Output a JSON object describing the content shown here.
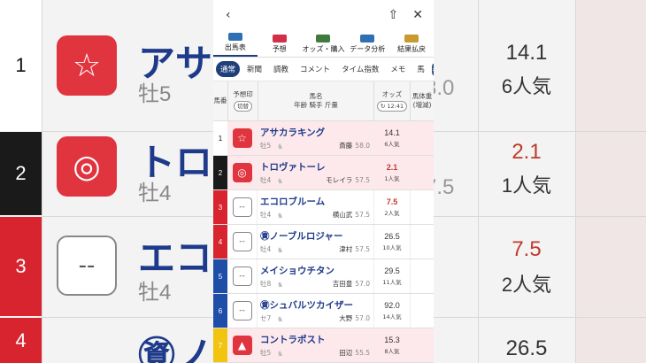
{
  "topbar": {
    "back_icon": "‹",
    "share_icon": "⇧",
    "close_icon": "✕"
  },
  "nav": [
    {
      "label": "出馬表",
      "icon": "table-icon",
      "color": "#2f6fb3",
      "active": true
    },
    {
      "label": "予想",
      "icon": "target-icon",
      "color": "#d0304a",
      "active": false
    },
    {
      "label": "オッズ・購入",
      "icon": "grid-icon",
      "color": "#3f7a3f",
      "active": false
    },
    {
      "label": "データ分析",
      "icon": "bar-chart-icon",
      "color": "#2f6fb3",
      "active": false
    },
    {
      "label": "結果払戻",
      "icon": "coins-icon",
      "color": "#c99a2e",
      "active": false
    }
  ],
  "subtabs": [
    "通常",
    "新聞",
    "調教",
    "コメント",
    "タイム指数",
    "メモ",
    "馬"
  ],
  "subtab_arrow": "›",
  "header": {
    "num": "馬番",
    "mark": "予想印",
    "mark_toggle": "切替",
    "name_line1": "馬名",
    "name_line2": "年齢 騎手 斤量",
    "odds": "オッズ",
    "odds_time": "12:41",
    "weight_line1": "馬体重",
    "weight_line2": "(増減)"
  },
  "horses": [
    {
      "num": "1",
      "gate_color": "#ffffff",
      "num_color": "#111",
      "mark": "☆",
      "mark_bg": "#e0343f",
      "name": "アサカラキング",
      "sub": "牡5",
      "jockey": "斎藤",
      "weight": "58.0",
      "odds": "14.1",
      "odds_red": false,
      "pop": "6人気",
      "pink": true
    },
    {
      "num": "2",
      "gate_color": "#1a1a1a",
      "num_color": "#fff",
      "mark": "◎",
      "mark_bg": "#e0343f",
      "name": "トロヴァトーレ",
      "sub": "牡4",
      "jockey": "モレイラ",
      "weight": "57.5",
      "odds": "2.1",
      "odds_red": true,
      "pop": "1人気",
      "pink": true
    },
    {
      "num": "3",
      "gate_color": "#d8242e",
      "num_color": "#fff",
      "mark": "--",
      "mark_bg": "",
      "name": "エコロブルーム",
      "sub": "牡4",
      "jockey": "横山武",
      "weight": "57.5",
      "odds": "7.5",
      "odds_red": true,
      "pop": "2人気",
      "pink": false
    },
    {
      "num": "4",
      "gate_color": "#d8242e",
      "num_color": "#fff",
      "mark": "--",
      "mark_bg": "",
      "name": "㊮ノーブルロジャー",
      "sub": "牡4",
      "jockey": "津村",
      "weight": "57.5",
      "odds": "26.5",
      "odds_red": false,
      "pop": "10人気",
      "pink": false
    },
    {
      "num": "5",
      "gate_color": "#1f4ea8",
      "num_color": "#fff",
      "mark": "--",
      "mark_bg": "",
      "name": "メイショウチタン",
      "sub": "牡8",
      "jockey": "吉田豊",
      "weight": "57.0",
      "odds": "29.5",
      "odds_red": false,
      "pop": "11人気",
      "pink": false
    },
    {
      "num": "6",
      "gate_color": "#1f4ea8",
      "num_color": "#fff",
      "mark": "--",
      "mark_bg": "",
      "name": "㊮シュバルツカイザー",
      "sub": "セ7",
      "jockey": "大野",
      "weight": "57.0",
      "odds": "92.0",
      "odds_red": false,
      "pop": "14人気",
      "pink": false
    },
    {
      "num": "7",
      "gate_color": "#f1c40f",
      "num_color": "#fff",
      "mark": "▲",
      "mark_bg": "#e0343f",
      "name": "コントラポスト",
      "sub": "牡5",
      "jockey": "田辺",
      "weight": "55.5",
      "odds": "15.3",
      "odds_red": false,
      "pop": "8人気",
      "pink": true
    }
  ],
  "background": {
    "rows": [
      {
        "num": "1",
        "name": "アサカ",
        "sub": "牡5",
        "odds": "14.1",
        "pop": "6人気",
        "mark": "☆",
        "extra": "8.0"
      },
      {
        "num": "2",
        "name": "トロヴ",
        "sub": "牡4",
        "odds": "2.1",
        "pop": "1人気",
        "mark": "◎",
        "extra": "7.5"
      },
      {
        "num": "3",
        "name": "エコロ",
        "sub": "牡4",
        "odds": "7.5",
        "pop": "2人気",
        "mark": "--",
        "extra": ""
      },
      {
        "num": "4",
        "name": "㊮ノー",
        "sub": "",
        "odds": "26.5",
        "pop": "",
        "mark": "--",
        "extra": ""
      }
    ]
  }
}
